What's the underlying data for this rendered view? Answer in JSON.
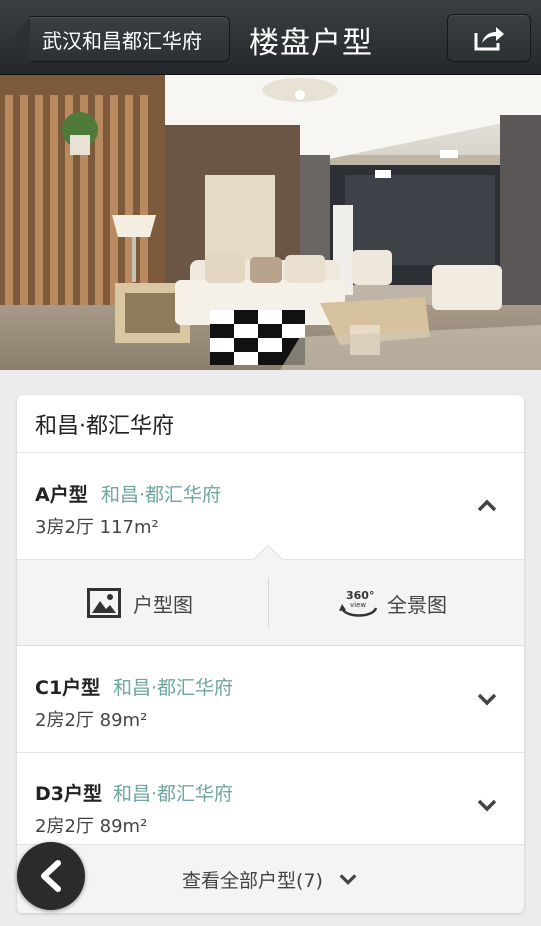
{
  "header": {
    "back_label": "武汉和昌都汇华府",
    "title": "楼盘户型"
  },
  "card": {
    "title": "和昌·都汇华府",
    "units": [
      {
        "name": "A户型",
        "estate": "和昌·都汇华府",
        "spec": "3房2厅 117m²",
        "expanded": true
      },
      {
        "name": "C1户型",
        "estate": "和昌·都汇华府",
        "spec": "2房2厅 89m²",
        "expanded": false
      },
      {
        "name": "D3户型",
        "estate": "和昌·都汇华府",
        "spec": "2房2厅 89m²",
        "expanded": false
      }
    ],
    "sub_actions": {
      "floorplan_label": "户型图",
      "panorama_label": "全景图",
      "panorama_icon_text": "360°",
      "panorama_icon_sub": "view"
    },
    "view_all_label": "查看全部户型(7)"
  },
  "colors": {
    "header_bg": "#2b3033",
    "estate_text": "#6fa6a0"
  }
}
